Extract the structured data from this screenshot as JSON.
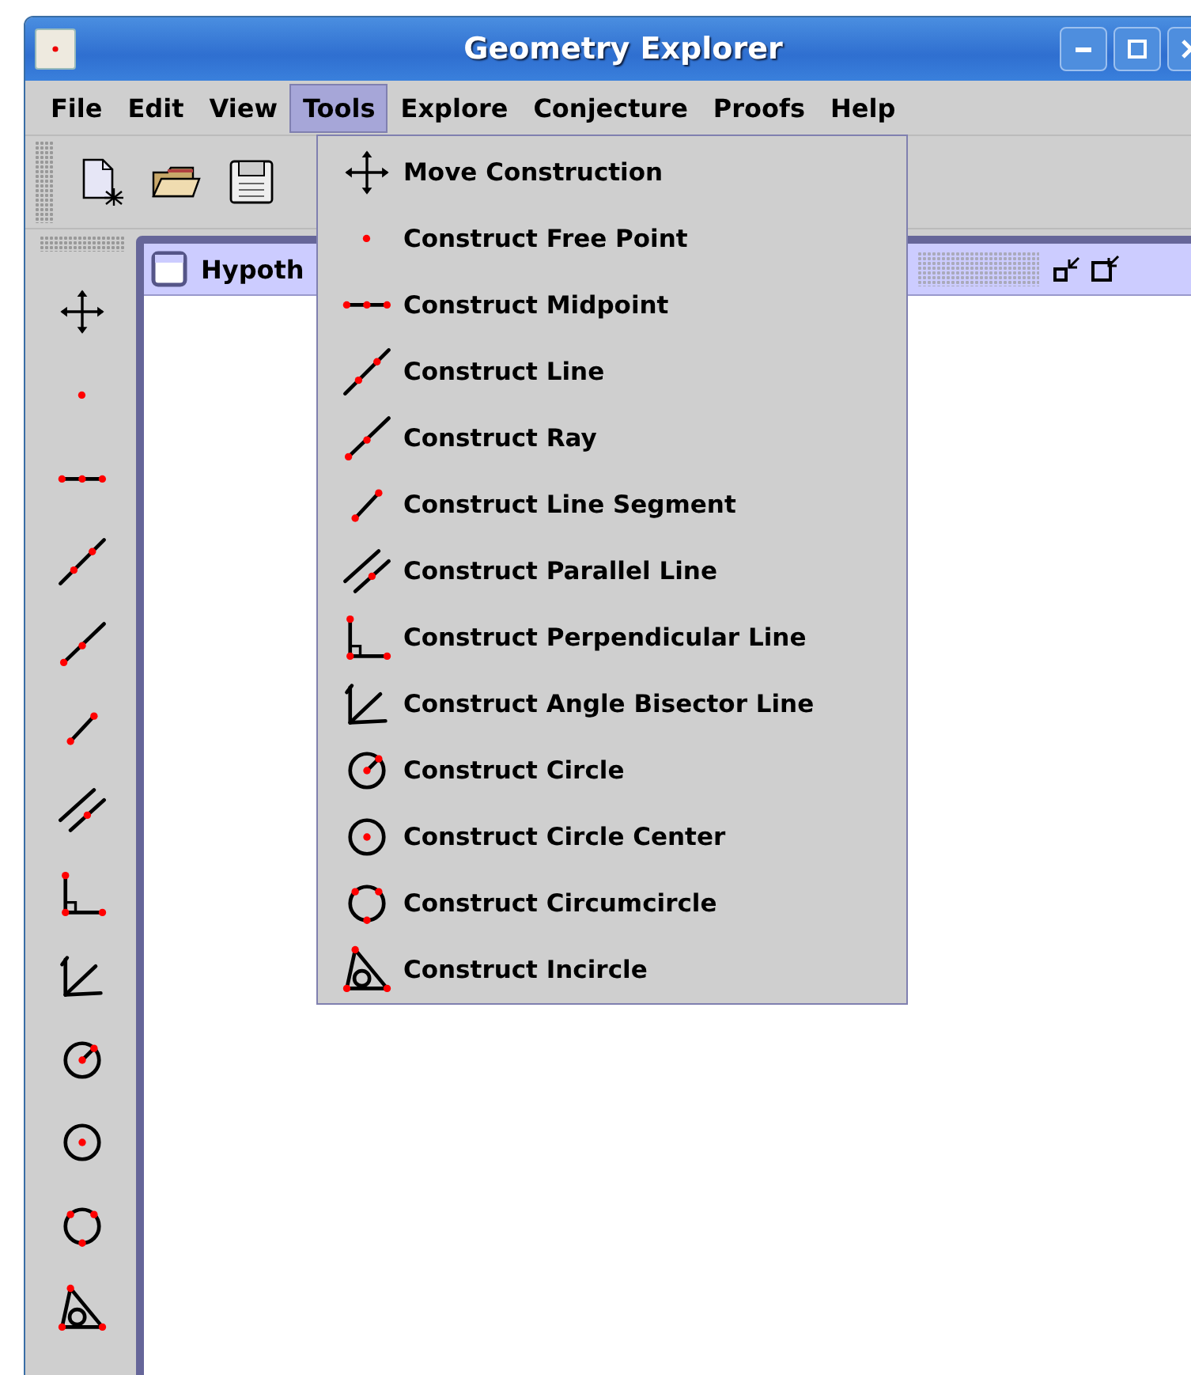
{
  "window": {
    "title": "Geometry Explorer"
  },
  "menu_bar": [
    {
      "label": "File",
      "selected": false
    },
    {
      "label": "Edit",
      "selected": false
    },
    {
      "label": "View",
      "selected": false
    },
    {
      "label": "Tools",
      "selected": true
    },
    {
      "label": "Explore",
      "selected": false
    },
    {
      "label": "Conjecture",
      "selected": false
    },
    {
      "label": "Proofs",
      "selected": false
    },
    {
      "label": "Help",
      "selected": false
    }
  ],
  "toolbar": [
    {
      "kind": "new"
    },
    {
      "kind": "open"
    },
    {
      "kind": "save"
    }
  ],
  "tool_palette": [
    {
      "kind": "move"
    },
    {
      "kind": "point"
    },
    {
      "kind": "midpoint"
    },
    {
      "kind": "line"
    },
    {
      "kind": "ray"
    },
    {
      "kind": "segment"
    },
    {
      "kind": "parallel"
    },
    {
      "kind": "perpendicular"
    },
    {
      "kind": "bisector"
    },
    {
      "kind": "circle"
    },
    {
      "kind": "circle-center"
    },
    {
      "kind": "circumcircle"
    },
    {
      "kind": "incircle"
    }
  ],
  "internal_frame": {
    "title": "Hypoth"
  },
  "tools_menu": [
    {
      "label": "Move Construction",
      "kind": "move"
    },
    {
      "label": "Construct Free Point",
      "kind": "point"
    },
    {
      "label": "Construct Midpoint",
      "kind": "midpoint"
    },
    {
      "label": "Construct Line",
      "kind": "line"
    },
    {
      "label": "Construct Ray",
      "kind": "ray"
    },
    {
      "label": "Construct Line Segment",
      "kind": "segment"
    },
    {
      "label": "Construct Parallel Line",
      "kind": "parallel"
    },
    {
      "label": "Construct Perpendicular Line",
      "kind": "perpendicular"
    },
    {
      "label": "Construct Angle Bisector Line",
      "kind": "bisector"
    },
    {
      "label": "Construct Circle",
      "kind": "circle"
    },
    {
      "label": "Construct Circle Center",
      "kind": "circle-center"
    },
    {
      "label": "Construct Circumcircle",
      "kind": "circumcircle"
    },
    {
      "label": "Construct Incircle",
      "kind": "incircle"
    }
  ]
}
